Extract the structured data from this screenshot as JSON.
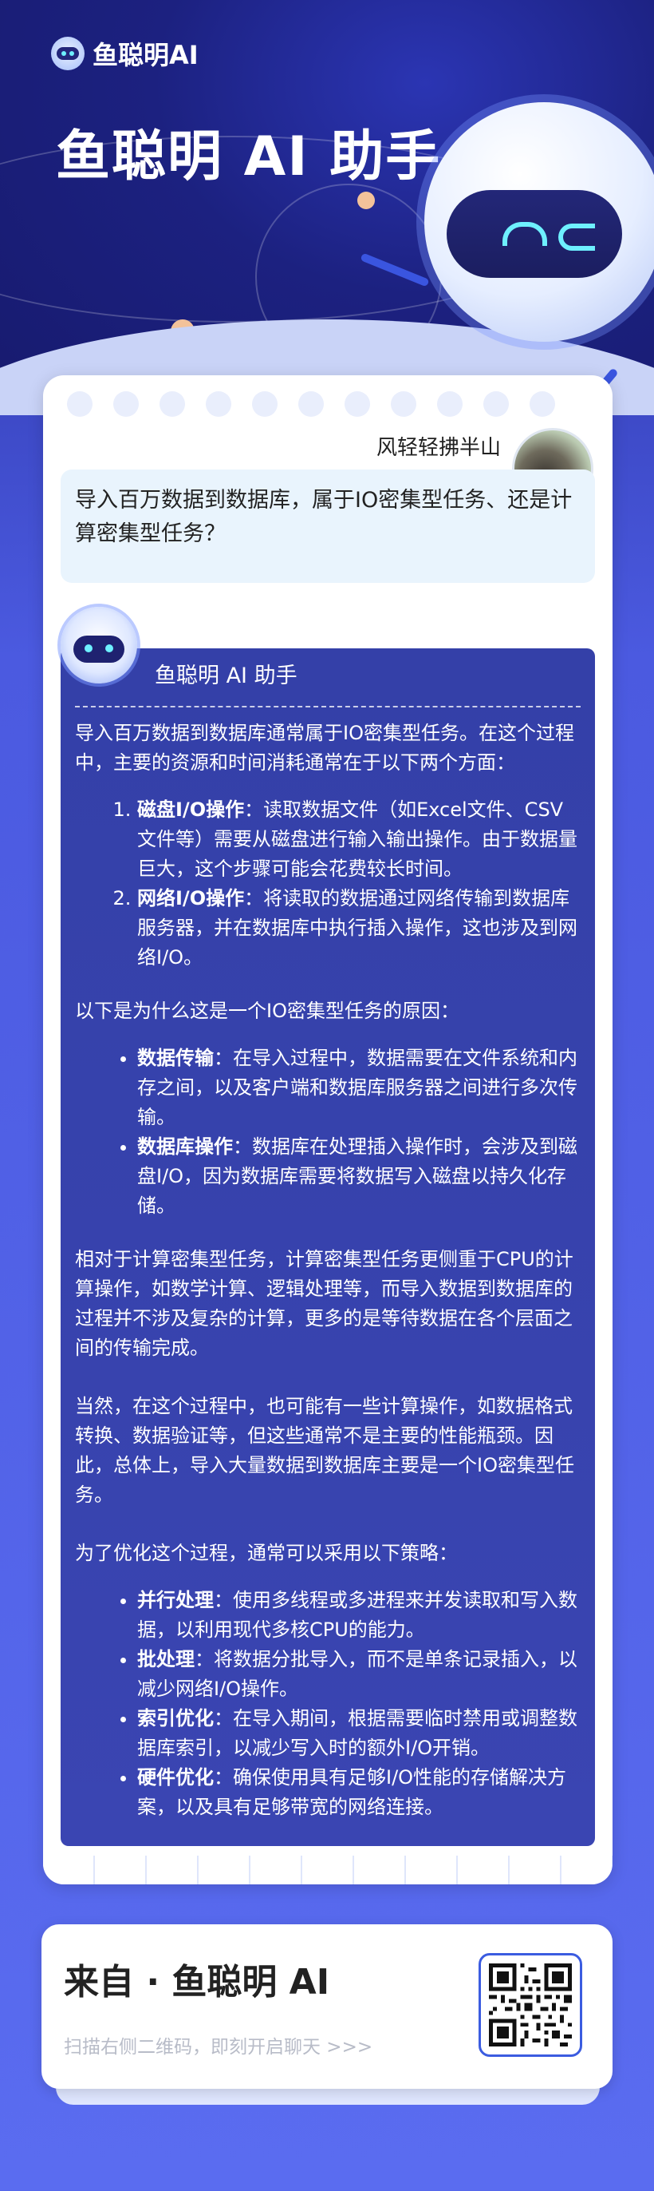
{
  "brand": {
    "name": "鱼聪明AI"
  },
  "hero": {
    "title": "鱼聪明 AI 助手"
  },
  "user": {
    "name": "风轻轻拂半山"
  },
  "question": "导入百万数据到数据库，属于IO密集型任务、还是计算密集型任务？",
  "bot": {
    "name": "鱼聪明 AI 助手"
  },
  "answer": {
    "intro": "导入百万数据到数据库通常属于IO密集型任务。在这个过程中，主要的资源和时间消耗通常在于以下两个方面：",
    "ordered": [
      {
        "term": "磁盘I/O操作",
        "text": "：读取数据文件（如Excel文件、CSV文件等）需要从磁盘进行输入输出操作。由于数据量巨大，这个步骤可能会花费较长时间。"
      },
      {
        "term": "网络I/O操作",
        "text": "：将读取的数据通过网络传输到数据库服务器，并在数据库中执行插入操作，这也涉及到网络I/O。"
      }
    ],
    "reason_title": "以下是为什么这是一个IO密集型任务的原因：",
    "reasons": [
      {
        "term": "数据传输",
        "text": "：在导入过程中，数据需要在文件系统和内存之间，以及客户端和数据库服务器之间进行多次传输。"
      },
      {
        "term": "数据库操作",
        "text": "：数据库在处理插入操作时，会涉及到磁盘I/O，因为数据库需要将数据写入磁盘以持久化存储。"
      }
    ],
    "para2": "相对于计算密集型任务，计算密集型任务更侧重于CPU的计算操作，如数学计算、逻辑处理等，而导入数据到数据库的过程并不涉及复杂的计算，更多的是等待数据在各个层面之间的传输完成。",
    "para3": "当然，在这个过程中，也可能有一些计算操作，如数据格式转换、数据验证等，但这些通常不是主要的性能瓶颈。因此，总体上，导入大量数据到数据库主要是一个IO密集型任务。",
    "strategy_title": "为了优化这个过程，通常可以采用以下策略：",
    "strategies": [
      {
        "term": "并行处理",
        "text": "：使用多线程或多进程来并发读取和写入数据，以利用现代多核CPU的能力。"
      },
      {
        "term": "批处理",
        "text": "：将数据分批导入，而不是单条记录插入，以减少网络I/O操作。"
      },
      {
        "term": "索引优化",
        "text": "：在导入期间，根据需要临时禁用或调整数据库索引，以减少写入时的额外I/O开销。"
      },
      {
        "term": "硬件优化",
        "text": "：确保使用具有足够I/O性能的存储解决方案，以及具有足够带宽的网络连接。"
      }
    ]
  },
  "footer": {
    "title": "来自 · 鱼聪明 AI",
    "subtitle": "扫描右侧二维码，即刻开启聊天 >>>"
  },
  "colors": {
    "accent": "#3a45b2",
    "question_bg": "#e9f4fd",
    "icon_cyan": "#6ef0ff"
  },
  "icons": [
    "brand-logo-icon",
    "mascot-icon",
    "user-avatar",
    "bot-avatar-icon",
    "qr-code-icon"
  ]
}
